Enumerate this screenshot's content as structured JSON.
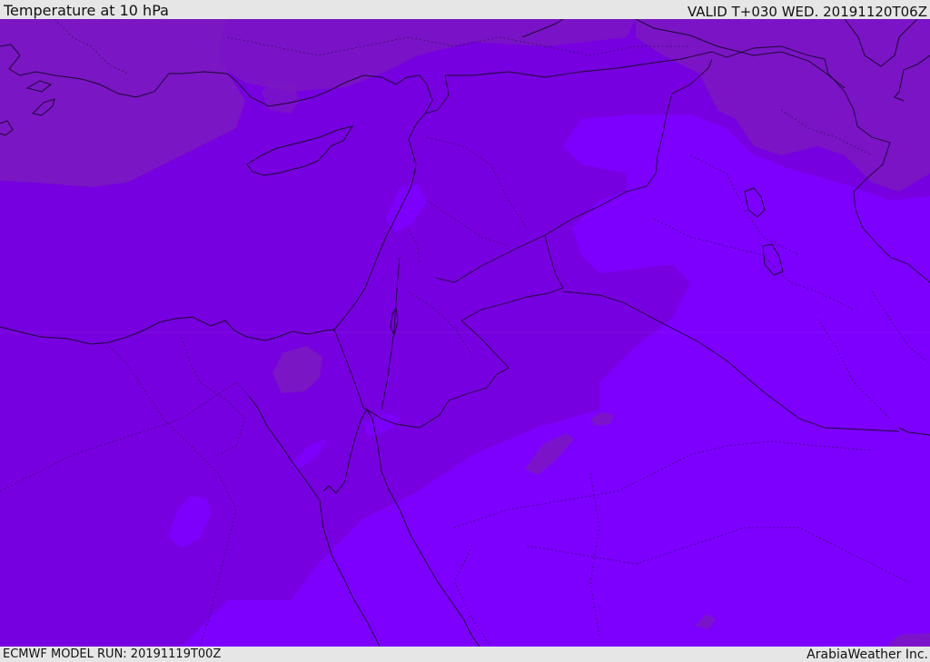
{
  "header": {
    "title": "Temperature at 10 hPa",
    "valid": "VALID T+030 WED. 20191120T06Z"
  },
  "footer": {
    "model_run": "ECMWF MODEL RUN: 20191119T00Z",
    "credit": "ArabiaWeather Inc."
  },
  "map": {
    "colors": {
      "cold": "#7700e0",
      "colder": "#7d00ff",
      "warm": "#7a18c0",
      "coast": "#1a0a30"
    }
  }
}
